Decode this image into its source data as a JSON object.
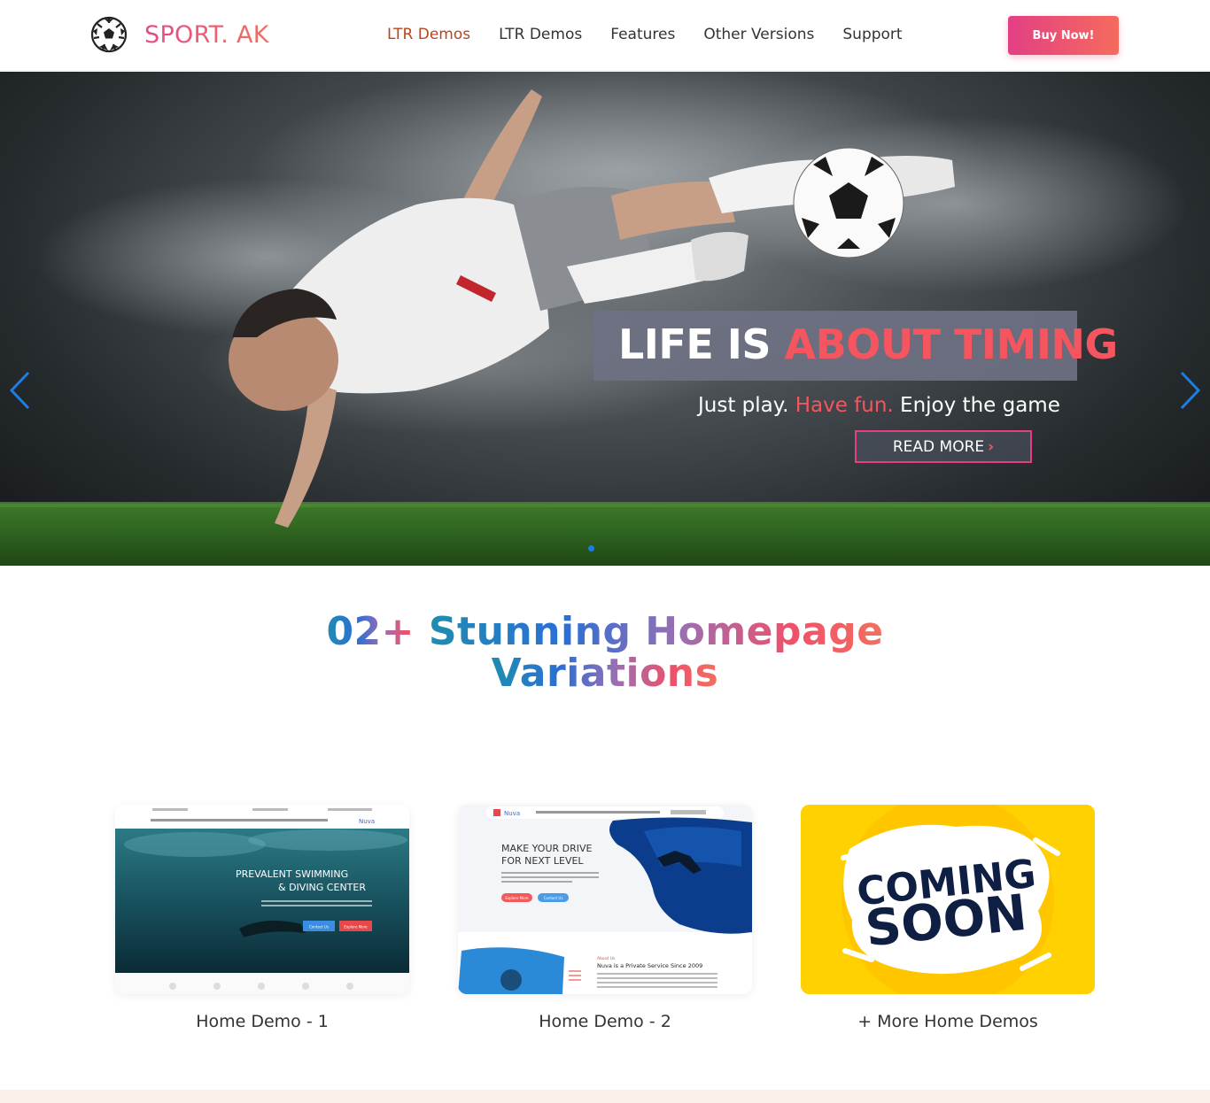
{
  "brand": {
    "name": "SPORT. AK",
    "logo_icon": "soccer-ball-icon"
  },
  "nav": {
    "items": [
      {
        "label": "LTR Demos",
        "active": true
      },
      {
        "label": "LTR Demos",
        "active": false
      },
      {
        "label": "Features",
        "active": false
      },
      {
        "label": "Other Versions",
        "active": false
      },
      {
        "label": "Support",
        "active": false
      }
    ],
    "buy_label": "Buy Now!"
  },
  "hero": {
    "headline_part1": "LIFE IS ",
    "headline_part2": "ABOUT TIMING",
    "tagline_part1": "Just play. ",
    "tagline_part2": "Have fun.",
    "tagline_part3": " Enjoy the game",
    "cta_label": "READ MORE",
    "cta_icon": "chevron-right-icon",
    "prev_icon": "chevron-left-icon",
    "next_icon": "chevron-right-icon",
    "slide_indicator_active": 1
  },
  "section": {
    "title_line1_a": "02+ ",
    "title_line1_b": "Stunning Homepage",
    "title_line2": "Variations"
  },
  "demos": [
    {
      "label": "Home Demo - 1",
      "preview": {
        "heading_line1": "PREVALENT SWIMMING",
        "heading_line2": "& DIVING CENTER",
        "brand": "Nuva",
        "btn1": "Contact Us",
        "btn2": "Explore More"
      }
    },
    {
      "label": "Home Demo - 2",
      "preview": {
        "brand": "Nuva",
        "heading_line1": "MAKE YOUR DRIVE",
        "heading_line2": "FOR NEXT LEVEL",
        "btn1": "Explore More",
        "btn2": "Contact Us",
        "about_kicker": "About Us",
        "about_title": "Nuva is a Private Service Since 2009"
      }
    },
    {
      "label": "+ More Home Demos",
      "preview": {
        "line1": "COMING",
        "line2": "SOON"
      }
    }
  ],
  "colors": {
    "accent_pink": "#e43f83",
    "accent_coral": "#f4555e",
    "active_nav": "#b5461e",
    "slide_dot": "#1e7de2",
    "coming_soon_yellow": "#ffd100"
  }
}
